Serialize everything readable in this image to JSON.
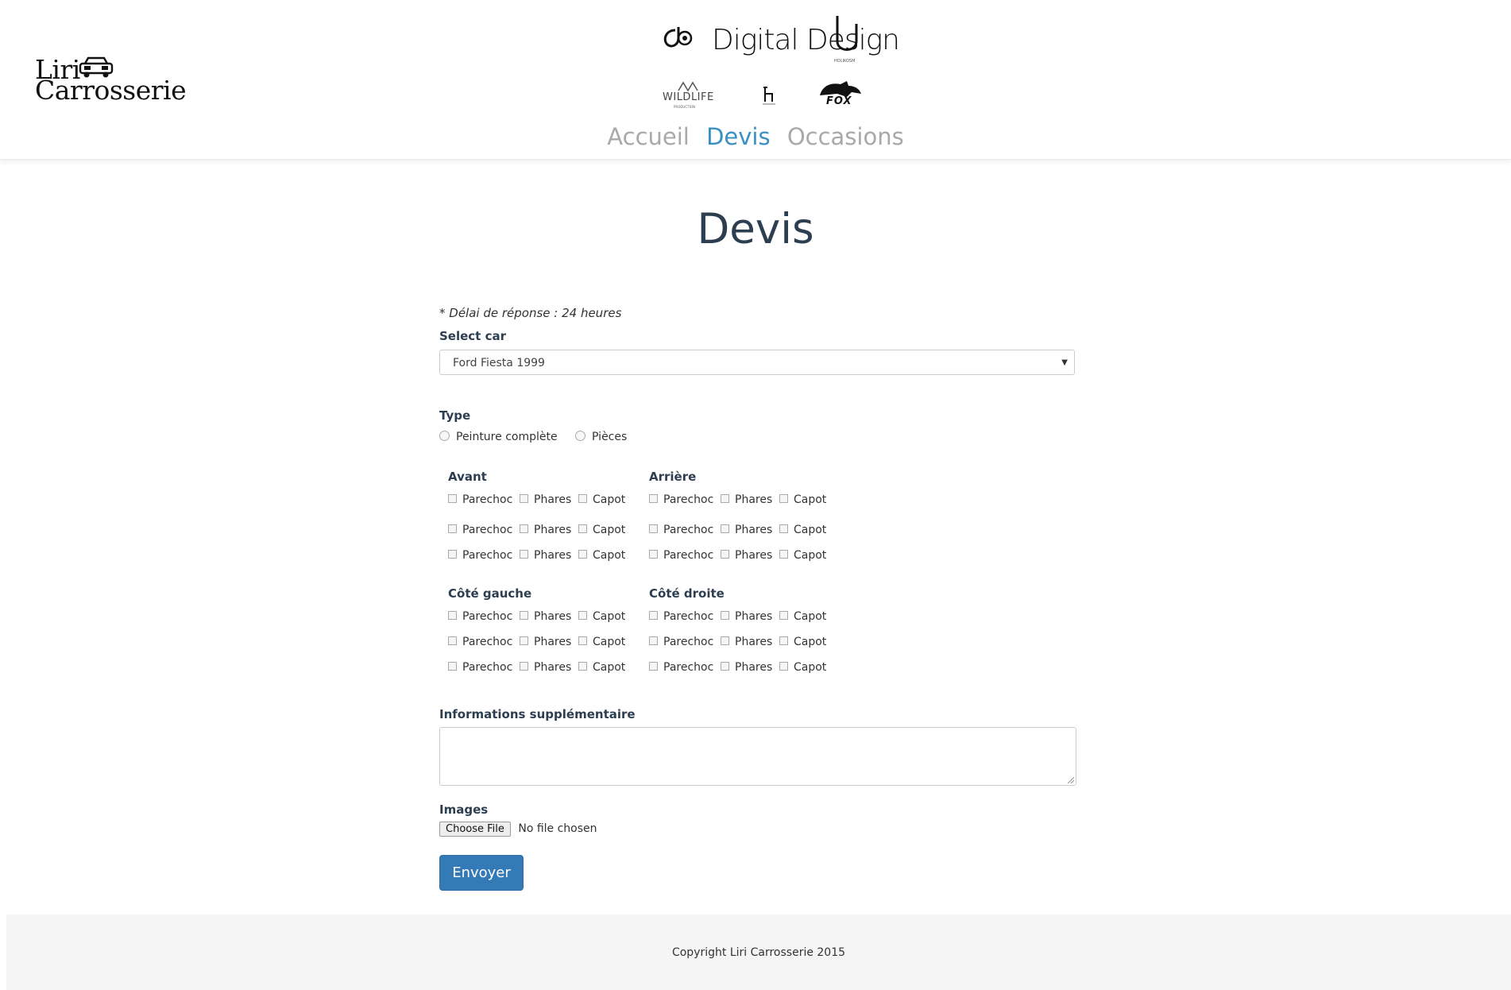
{
  "brand": {
    "line1": "Liri",
    "line2": "Carrosserie"
  },
  "partners": {
    "digital_design": "Digital Design",
    "holikosm": "HOLIKOSM",
    "wildlife": "WILDLIFE",
    "wildlife_sub": "PRODUCTION",
    "fox": "FOX"
  },
  "nav": {
    "items": [
      "Accueil",
      "Devis",
      "Occasions"
    ],
    "active": "Devis"
  },
  "page": {
    "title": "Devis"
  },
  "form": {
    "note": "* Délai de réponse : 24 heures",
    "select_label": "Select car",
    "select_value": "Ford Fiesta 1999",
    "type_label": "Type",
    "type_options": [
      "Peinture complète",
      "Pièces"
    ],
    "groups": {
      "avant": "Avant",
      "arriere": "Arrière",
      "cote_gauche": "Côté gauche",
      "cote_droite": "Côté droite"
    },
    "checkbox_labels": [
      "Parechoc",
      "Phares",
      "Capot"
    ],
    "info_label": "Informations supplémentaire",
    "info_value": "",
    "images_label": "Images",
    "file_button": "Choose File",
    "file_status": "No file chosen",
    "submit_label": "Envoyer"
  },
  "footer": {
    "copyright": "Copyright Liri Carrosserie 2015"
  }
}
